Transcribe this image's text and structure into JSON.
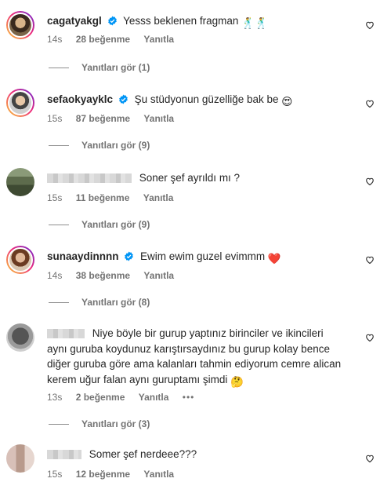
{
  "comments": [
    {
      "username": "cagatyakgl",
      "verified": true,
      "text": "Yesss beklenen fragman",
      "emojis": "🕺🕺",
      "time": "14s",
      "likes": "28 beğenme",
      "reply": "Yanıtla",
      "replies": "Yanıtları gör (1)"
    },
    {
      "username": "sefaokyayklc",
      "verified": true,
      "text": "Şu stüdyonun güzelliğe bak be",
      "emojis": "😍",
      "time": "15s",
      "likes": "87 beğenme",
      "reply": "Yanıtla",
      "replies": "Yanıtları gör (9)"
    },
    {
      "username": "",
      "verified": false,
      "text": "Soner şef ayrıldı mı ?",
      "time": "15s",
      "likes": "11 beğenme",
      "reply": "Yanıtla",
      "replies": "Yanıtları gör (9)"
    },
    {
      "username": "sunaaydinnnn",
      "verified": true,
      "text": "Ewim ewim guzel evimmm",
      "emojis": "❤️",
      "time": "14s",
      "likes": "38 beğenme",
      "reply": "Yanıtla",
      "replies": "Yanıtları gör (8)"
    },
    {
      "username": "",
      "verified": false,
      "text_lines": [
        "Niye böyle bir gurup yaptınız birinciler ve ikincileri",
        "aynı guruba koydunuz karıştırsaydınız bu gurup kolay bence",
        "diğer guruba göre ama kalanları tahmin ediyorum cemre alican",
        "kerem uğur falan aynı guruptamı şimdi"
      ],
      "emojis": "🤔",
      "time": "13s",
      "likes": "2 beğenme",
      "reply": "Yanıtla",
      "more": "•••",
      "replies": "Yanıtları gör (3)"
    },
    {
      "username": "",
      "verified": false,
      "text": "Somer şef nerdeee???",
      "time": "15s",
      "likes": "12 beğenme",
      "reply": "Yanıtla"
    }
  ],
  "colors": {
    "text": "#262626",
    "secondary": "#737373",
    "verified": "#0095f6",
    "ring_gradient": [
      "#f9ce34",
      "#ee2a7b",
      "#6228d7"
    ]
  },
  "icons": {
    "like": "heart-outline-icon",
    "verified": "verified-badge-icon"
  }
}
